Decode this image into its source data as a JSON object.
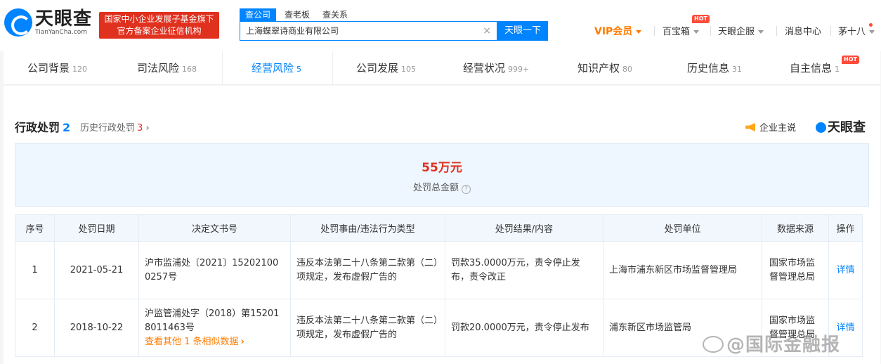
{
  "header": {
    "logo_cn": "天眼查",
    "logo_en": "TianYanCha.com",
    "badge_line1": "国家中小企业发展子基金旗下",
    "badge_line2": "官方备案企业征信机构",
    "search_tabs": [
      "查公司",
      "查老板",
      "查关系"
    ],
    "search_value": "上海蝶翠诗商业有限公司",
    "search_button": "天眼一下",
    "vip_label": "VIP会员",
    "nav": [
      "百宝箱",
      "天眼企服",
      "消息中心",
      "茅十八"
    ],
    "hot_label": "HOT"
  },
  "tabs": [
    {
      "label": "公司背景",
      "count": "120"
    },
    {
      "label": "司法风险",
      "count": "168"
    },
    {
      "label": "经营风险",
      "count": "5"
    },
    {
      "label": "公司发展",
      "count": "105"
    },
    {
      "label": "经营状况",
      "count": "999+"
    },
    {
      "label": "知识产权",
      "count": "80"
    },
    {
      "label": "历史信息",
      "count": "31"
    },
    {
      "label": "自主信息",
      "count": "1"
    }
  ],
  "section": {
    "title": "行政处罚",
    "count": "2",
    "history_label": "历史行政处罚",
    "history_count": "3",
    "speak_label": "企业主说",
    "brand": "天眼查",
    "total_amount": "55万元",
    "total_label": "处罚总金额"
  },
  "table": {
    "headers": [
      "序号",
      "处罚日期",
      "决定文书号",
      "处罚事由/违法行为类型",
      "处罚结果/内容",
      "处罚单位",
      "数据来源",
      "操作"
    ],
    "rows": [
      {
        "no": "1",
        "date": "2021-05-21",
        "doc": "沪市监浦处〔2021〕15202100 0257号",
        "reason": "违反本法第二十八条第二款第（二）项规定，发布虚假广告的",
        "result": "罚款35.0000万元，责令停止发布，责令改正",
        "unit": "上海市浦东新区市场监督管理局",
        "source": "国家市场监督管理总局",
        "action": "详情"
      },
      {
        "no": "2",
        "date": "2018-10-22",
        "doc": "沪监管浦处字（2018）第15201 8011463号",
        "similar": "查看其他 1 条相似数据",
        "reason": "违反本法第二十八条第二款第（二）项规定，发布虚假广告的",
        "result": "罚款20.0000万元，责令停止发布",
        "unit": "浦东新区市场监管局",
        "source": "国家市场监督管理总局",
        "action": "详情"
      }
    ]
  },
  "watermark": "@国际金融报"
}
